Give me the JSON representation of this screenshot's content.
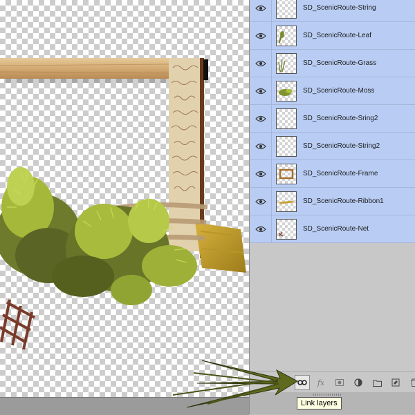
{
  "layers_panel": {
    "layers": [
      {
        "name": "SD_ScenicRoute-String",
        "thumb": "empty"
      },
      {
        "name": "SD_ScenicRoute-Leaf",
        "thumb": "leaf"
      },
      {
        "name": "SD_ScenicRoute-Grass",
        "thumb": "grass"
      },
      {
        "name": "SD_ScenicRoute-Moss",
        "thumb": "moss"
      },
      {
        "name": "SD_ScenicRoute-Sring2",
        "thumb": "empty"
      },
      {
        "name": "SD_ScenicRoute-String2",
        "thumb": "empty"
      },
      {
        "name": "SD_ScenicRoute-Frame",
        "thumb": "frame"
      },
      {
        "name": "SD_ScenicRoute-Ribbon1",
        "thumb": "ribbon"
      },
      {
        "name": "SD_ScenicRoute-Net",
        "thumb": "net"
      }
    ],
    "footer_tools": [
      {
        "id": "link",
        "icon": "link-icon",
        "label": "Link layers"
      },
      {
        "id": "fx",
        "icon": "fx-icon",
        "text": "fx"
      },
      {
        "id": "mask",
        "icon": "mask-icon"
      },
      {
        "id": "adjust",
        "icon": "adjustment-layer-icon"
      },
      {
        "id": "group",
        "icon": "folder-icon"
      },
      {
        "id": "new",
        "icon": "new-layer-icon"
      },
      {
        "id": "delete",
        "icon": "trash-icon"
      }
    ]
  },
  "tooltip": {
    "text": "Link layers"
  },
  "colors": {
    "selected_layer_bg": "#b9cdf4",
    "panel_bg": "#c8c8c8",
    "tooltip_bg": "#ffffe1"
  }
}
